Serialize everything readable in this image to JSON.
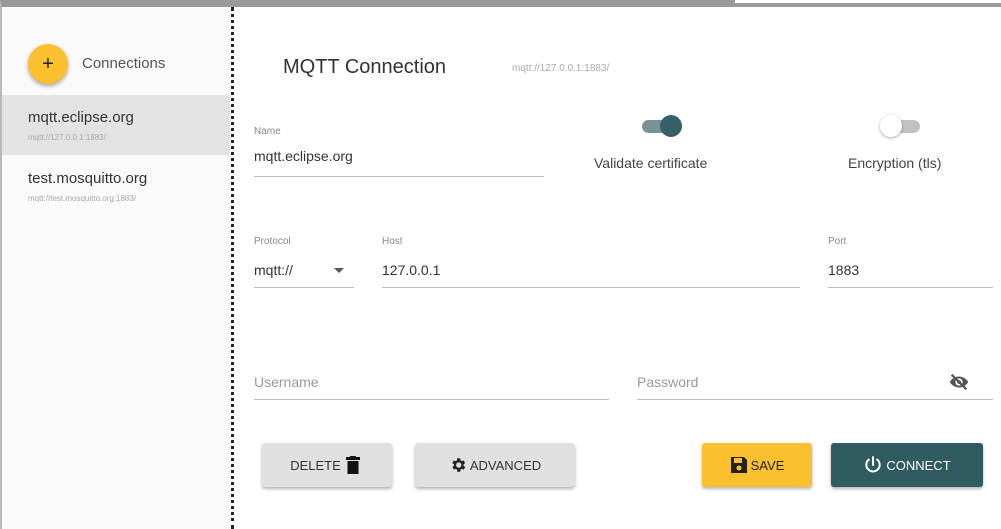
{
  "sidebar": {
    "add_label": "+",
    "title": "Connections",
    "items": [
      {
        "name": "mqtt.eclipse.org",
        "url": "mqtt://127.0.0.1:1883/"
      },
      {
        "name": "test.mosquitto.org",
        "url": "mqtt://test.mosquitto.org:1883/"
      }
    ]
  },
  "main": {
    "title": "MQTT Connection",
    "url": "mqtt://127.0.0.1:1883/",
    "name_label": "Name",
    "name_value": "mqtt.eclipse.org",
    "validate_label": "Validate certificate",
    "validate_on": true,
    "encryption_label": "Encryption (tls)",
    "encryption_on": false,
    "protocol_label": "Protocol",
    "protocol_value": "mqtt://",
    "host_label": "Host",
    "host_value": "127.0.0.1",
    "port_label": "Port",
    "port_value": "1883",
    "username_placeholder": "Username",
    "password_placeholder": "Password"
  },
  "buttons": {
    "delete": "DELETE",
    "advanced": "ADVANCED",
    "save": "SAVE",
    "connect": "CONNECT"
  },
  "colors": {
    "accent": "#fbc02d",
    "primary": "#2f5b61",
    "active_item": "#e3e3e3"
  },
  "icons": [
    "plus-icon",
    "trash-icon",
    "gear-icon",
    "save-icon",
    "power-icon",
    "eye-off-icon",
    "chevron-down-icon"
  ]
}
